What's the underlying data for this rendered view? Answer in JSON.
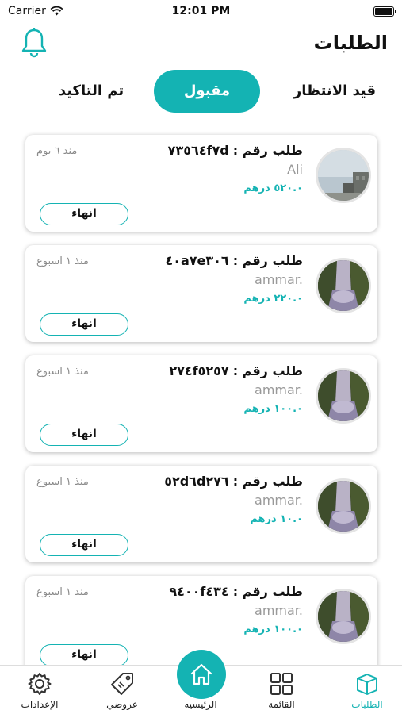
{
  "status_bar": {
    "carrier": "Carrier",
    "time": "12:01 PM"
  },
  "header": {
    "title": "الطلبات"
  },
  "tabs": [
    {
      "label": "قيد الانتظار",
      "active": false
    },
    {
      "label": "مقبول",
      "active": true
    },
    {
      "label": "تم التاكيد",
      "active": false
    }
  ],
  "orders": [
    {
      "title_prefix": "طلب رقم :",
      "number": "٧٣٥٦٤f٧d",
      "user": "Ali",
      "price": "٥٢٠.٠ درهم",
      "time": "منذ ٦ يوم",
      "button": "انهاء",
      "avatar": "building"
    },
    {
      "title_prefix": "طلب رقم :",
      "number": "٤٠a٧e٣٠٦",
      "user": "ammar.",
      "price": "٢٢٠.٠ درهم",
      "time": "منذ ١ اسبوع",
      "button": "انهاء",
      "avatar": "waterfall"
    },
    {
      "title_prefix": "طلب رقم :",
      "number": "٢٧٤f٥٢٥٧",
      "user": "ammar.",
      "price": "١٠٠.٠ درهم",
      "time": "منذ ١ اسبوع",
      "button": "انهاء",
      "avatar": "waterfall"
    },
    {
      "title_prefix": "طلب رقم :",
      "number": "٥٢d٦d٢٧٦",
      "user": "ammar.",
      "price": "١٠.٠ درهم",
      "time": "منذ ١ اسبوع",
      "button": "انهاء",
      "avatar": "waterfall"
    },
    {
      "title_prefix": "طلب رقم :",
      "number": "٩٤٠٠f٤٣٤",
      "user": "ammar.",
      "price": "١٠٠.٠ درهم",
      "time": "منذ ١ اسبوع",
      "button": "انهاء",
      "avatar": "waterfall"
    }
  ],
  "bottom_nav": {
    "orders": "الطلبات",
    "list": "القائمة",
    "home": "الرئيسيه",
    "offers": "عروضي",
    "settings": "الإعدادات"
  },
  "colors": {
    "accent": "#14b3b3",
    "muted_text": "#8a8a8a"
  },
  "icons": {
    "bell": "bell-icon",
    "orders": "box-icon",
    "list": "grid-icon",
    "home": "home-icon",
    "offers": "tag-icon",
    "settings": "gear-icon"
  }
}
